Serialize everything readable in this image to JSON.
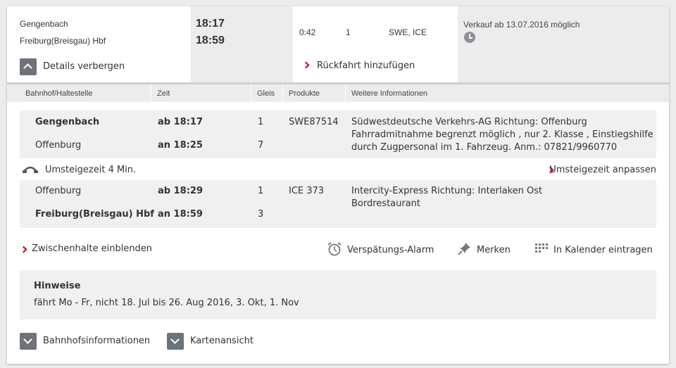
{
  "summary": {
    "from_station": "Gengenbach",
    "to_station": "Freiburg(Breisgau) Hbf",
    "dep_time": "18:17",
    "arr_time": "18:59",
    "duration": "0:42",
    "changes": "1",
    "products": "SWE, ICE",
    "sale_notice": "Verkauf ab 13.07.2016 möglich",
    "details_toggle_label": "Details verbergen",
    "return_trip_label": "Rückfahrt hinzufügen"
  },
  "table_header": {
    "station": "Bahnhof/Haltestelle",
    "time": "Zeit",
    "platform": "Gleis",
    "products": "Produkte",
    "info": "Weitere Informationen"
  },
  "legs": [
    {
      "from": "Gengenbach",
      "from_time": "ab 18:17",
      "from_platform": "1",
      "to": "Offenburg",
      "to_time": "an 18:25",
      "to_platform": "7",
      "product": "SWE87514",
      "info_lines": [
        "Südwestdeutsche Verkehrs-AG Richtung: Offenburg",
        "Fahrradmitnahme begrenzt möglich , nur 2. Klasse , Einstiegshilfe",
        "durch Zugpersonal im 1. Fahrzeug. Anm.: 07821/9960770"
      ]
    },
    {
      "from": "Offenburg",
      "from_time": "ab 18:29",
      "from_platform": "1",
      "to": "Freiburg(Breisgau) Hbf",
      "to_time": "an 18:59",
      "to_platform": "3",
      "product": "ICE 373",
      "info_lines": [
        "Intercity-Express Richtung: Interlaken Ost",
        "Bordrestaurant"
      ]
    }
  ],
  "transfer": {
    "label": "Umsteigezeit 4 Min.",
    "adjust_label": "Umsteigezeit anpassen"
  },
  "actions": {
    "intermediate_stops": "Zwischenhalte einblenden",
    "delay_alarm": "Verspätungs-Alarm",
    "bookmark": "Merken",
    "calendar": "In Kalender eintragen"
  },
  "notes": {
    "title": "Hinweise",
    "text": "fährt Mo - Fr, nicht 18. Jul bis 26. Aug 2016, 3. Okt, 1. Nov"
  },
  "bottom": {
    "station_info": "Bahnhofsinformationen",
    "map_view": "Kartenansicht"
  },
  "colors": {
    "accent_red": "#c50014",
    "icon_gray": "#6e737a",
    "panel_gray": "#ececec"
  }
}
